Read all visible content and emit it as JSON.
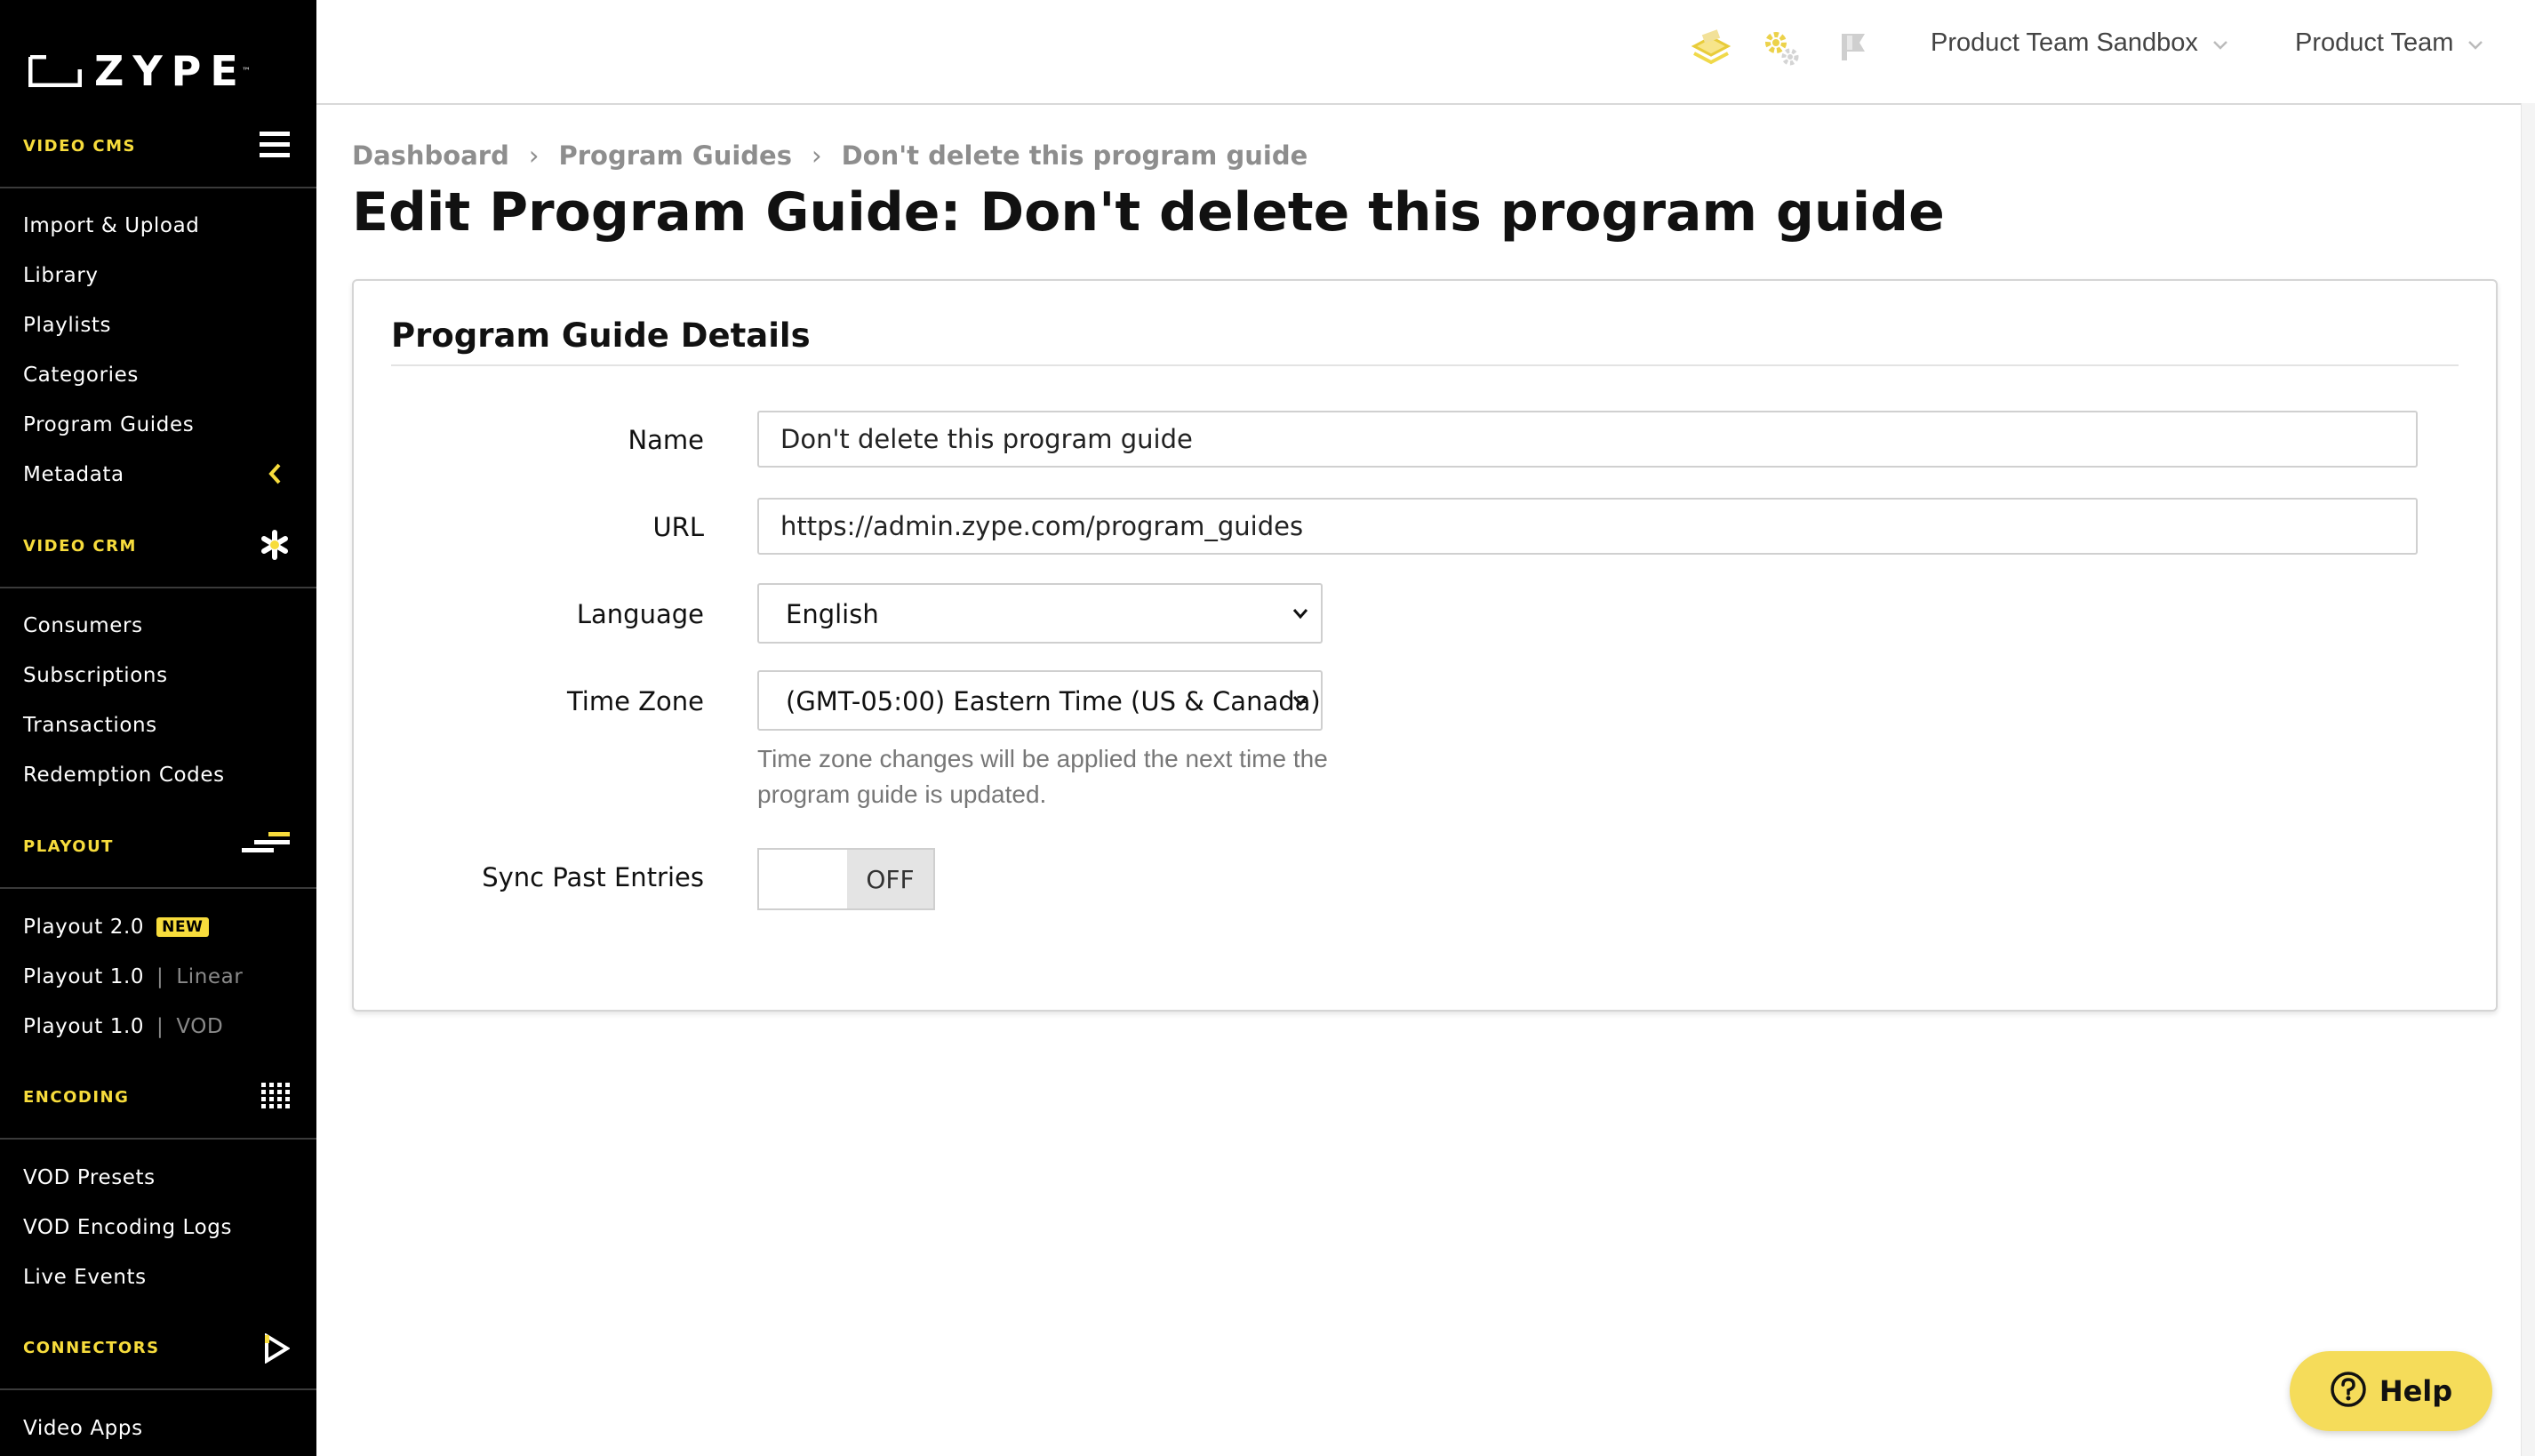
{
  "brand": {
    "name": "ZYPE",
    "trademark": "™"
  },
  "sidebar": {
    "sections": [
      {
        "title": "VIDEO CMS",
        "icon": "hamburger-icon",
        "items": [
          {
            "label": "Import & Upload"
          },
          {
            "label": "Library"
          },
          {
            "label": "Playlists"
          },
          {
            "label": "Categories"
          },
          {
            "label": "Program Guides"
          },
          {
            "label": "Metadata",
            "icon": "chevron-left-icon"
          }
        ]
      },
      {
        "title": "VIDEO CRM",
        "icon": "asterisk-icon",
        "items": [
          {
            "label": "Consumers"
          },
          {
            "label": "Subscriptions"
          },
          {
            "label": "Transactions"
          },
          {
            "label": "Redemption Codes"
          }
        ]
      },
      {
        "title": "PLAYOUT",
        "icon": "playout-lines-icon",
        "items": [
          {
            "label": "Playout 2.0",
            "badge": "NEW"
          },
          {
            "label": "Playout 1.0",
            "sub": "Linear",
            "sep": "|"
          },
          {
            "label": "Playout 1.0",
            "sub": "VOD",
            "sep": "|"
          }
        ]
      },
      {
        "title": "ENCODING",
        "icon": "grid-dots-icon",
        "items": [
          {
            "label": "VOD Presets"
          },
          {
            "label": "VOD Encoding Logs"
          },
          {
            "label": "Live Events"
          }
        ]
      },
      {
        "title": "CONNECTORS",
        "icon": "play-outline-icon",
        "items": [
          {
            "label": "Video Apps"
          }
        ]
      }
    ]
  },
  "topbar": {
    "icons": [
      "stack-icon",
      "gears-icon",
      "flag-icon"
    ],
    "site_dropdown": "Product Team Sandbox",
    "account_dropdown": "Product Team"
  },
  "breadcrumb": [
    "Dashboard",
    "Program Guides",
    "Don't delete this program guide"
  ],
  "breadcrumb_sep": "›",
  "page_title": "Edit Program Guide: Don't delete this program guide",
  "card": {
    "title": "Program Guide Details",
    "fields": {
      "name": {
        "label": "Name",
        "value": "Don't delete this program guide"
      },
      "url": {
        "label": "URL",
        "value": "https://admin.zype.com/program_guides"
      },
      "language": {
        "label": "Language",
        "value": "English"
      },
      "timezone": {
        "label": "Time Zone",
        "value": "(GMT-05:00) Eastern Time (US & Canada)",
        "help": "Time zone changes will be applied the next time the program guide is updated."
      },
      "sync": {
        "label": "Sync Past Entries",
        "state": "OFF"
      }
    }
  },
  "help_button": {
    "label": "Help",
    "icon": "question-circle-icon"
  },
  "colors": {
    "accent": "#f7dc3c",
    "help_bg": "#f5dc5a",
    "sidebar_bg": "#000000"
  }
}
